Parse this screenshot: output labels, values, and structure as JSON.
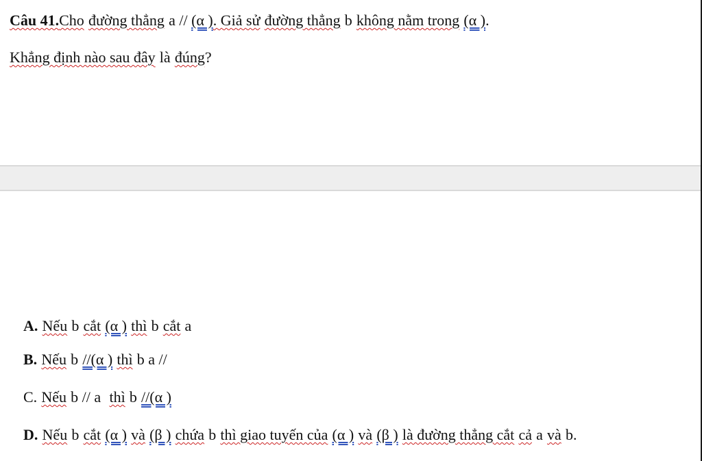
{
  "question": {
    "label": "Câu 41.",
    "text_1": "Cho",
    "text_2": "đường thẳng",
    "text_3": "a // ",
    "alpha_1": "(α )",
    "text_4": ". Giả sử",
    "text_5": "đường thẳng",
    "text_6": "b",
    "text_7": "không nằm trong",
    "alpha_2": "(α )",
    "text_8": ".",
    "line2_1": "Khẳng định nào sau đây",
    "line2_2": "là",
    "line2_3": "đúng",
    "line2_4": "?"
  },
  "options": {
    "a": {
      "label": "A.",
      "t1": "Nếu",
      "t2": "b",
      "t3": "cắt",
      "alpha": "(α )",
      "t4": "thì",
      "t5": "b",
      "t6": "cắt",
      "t7": "a"
    },
    "b": {
      "label": "B.",
      "t1": "Nếu",
      "t2": "b",
      "alpha": "//(α )",
      "t3": "thì",
      "t4": "b a //"
    },
    "c": {
      "label": "C.",
      "t1": "Nếu",
      "t2": "b // a",
      "t3": "thì",
      "t4": "b",
      "alpha": "//(α )"
    },
    "d": {
      "label": "D.",
      "t1": "Nếu",
      "t2": "b",
      "t3": "cắt",
      "alpha_1": "(α )",
      "t4": "và",
      "beta_1": "(β )",
      "t5": "chứa",
      "t6": "b",
      "t7": "thì giao tuyến của",
      "alpha_2": "(α )",
      "t8": "và",
      "beta_2": "(β )",
      "t9": "là đường thẳng cắt",
      "t10": "cả",
      "t11": "a",
      "t12": "và",
      "t13": "b."
    }
  }
}
